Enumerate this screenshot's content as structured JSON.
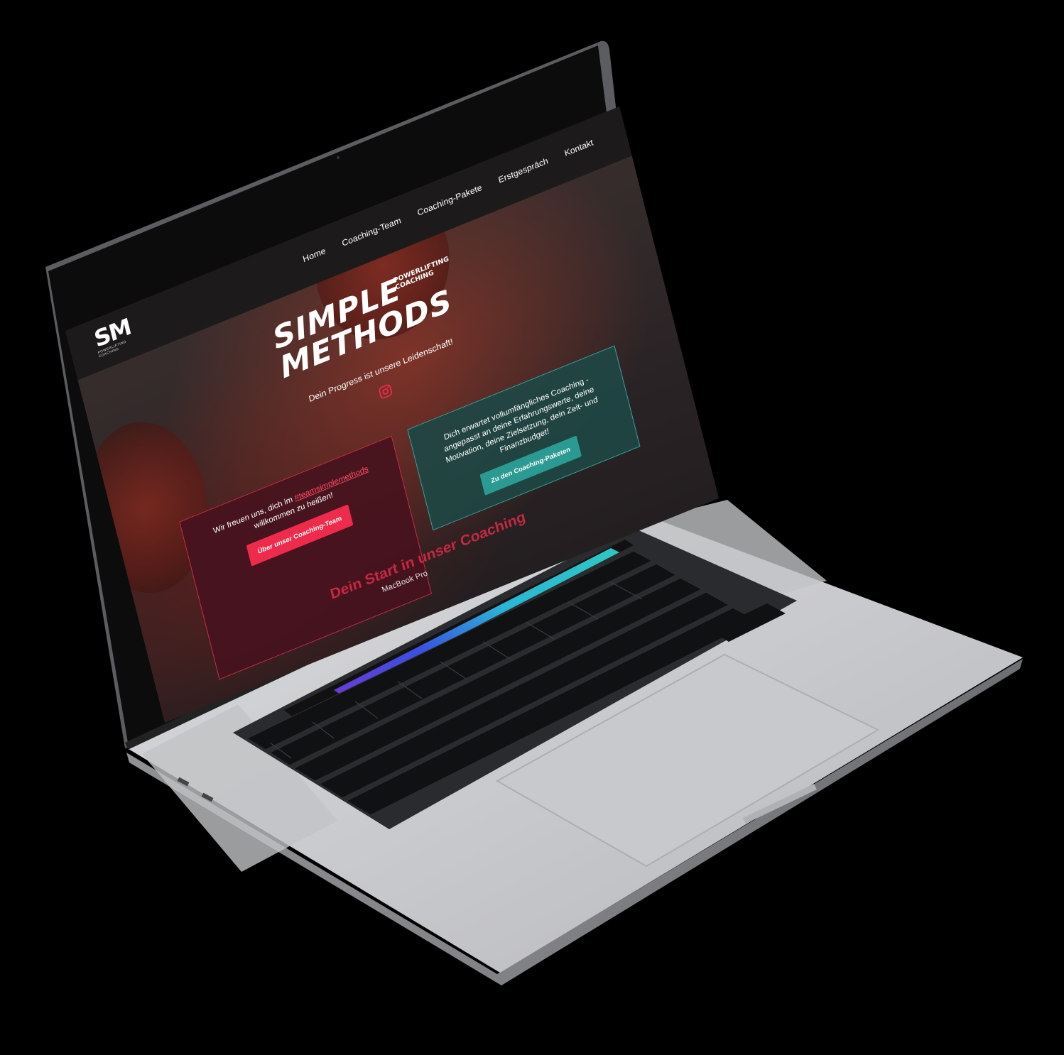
{
  "site": {
    "logo": {
      "mark": "SM",
      "sub": "POWERLIFTING COACHING"
    },
    "nav": [
      "Home",
      "Coaching-Team",
      "Coaching-Pakete",
      "Erstgespräch",
      "Kontakt"
    ],
    "brand": {
      "line1": "SIMPLE",
      "line2": "METHODS",
      "side1": "POWERLIFTING",
      "side2": "COACHING"
    },
    "tagline": "Dein Progress ist unsere Leidenschaft!",
    "card_welcome": {
      "text_before": "Wir freuen uns, dich im",
      "hashtag": "#teamsimplemethods",
      "text_after": "willkommen zu heißen!",
      "button": "Über unser Coaching-Team"
    },
    "card_packages": {
      "text": "Dich erwartet vollumfängliches Coaching - angepasst an deine Erfahrungswerte, deine Motivation, deine Zielsetzung, dein Zeit- und Finanzbudget!",
      "button": "Zu den Coaching-Paketen"
    },
    "section_title": "Dein Start in unser Coaching"
  },
  "device": {
    "label": "MacBook Pro"
  },
  "colors": {
    "accent_red": "#ef2b4c",
    "accent_teal": "#2b9a92",
    "bg_dark": "#1d1a1b"
  }
}
